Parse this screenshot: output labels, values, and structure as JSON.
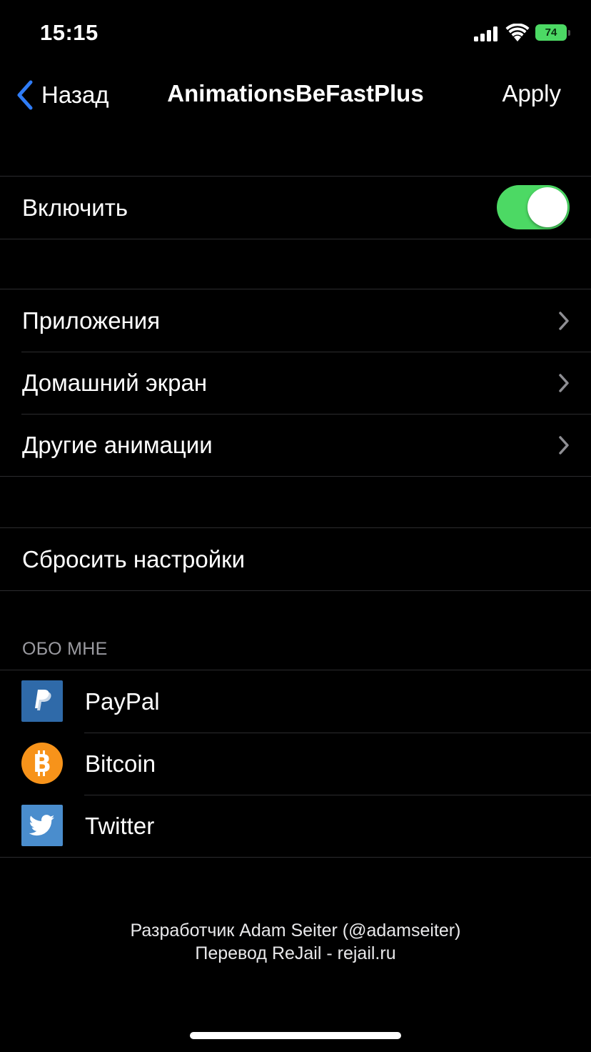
{
  "status_bar": {
    "time": "15:15",
    "battery": "74",
    "battery_color": "#4cd964"
  },
  "nav": {
    "back_label": "Назад",
    "title": "AnimationsBeFastPlus",
    "apply_label": "Apply",
    "back_icon": "chevron-left-icon"
  },
  "enable_group": {
    "label": "Включить",
    "toggle_on": true,
    "toggle_color": "#4cd964"
  },
  "menu_group": {
    "items": [
      {
        "label": "Приложения"
      },
      {
        "label": "Домашний экран"
      },
      {
        "label": "Другие анимации"
      }
    ]
  },
  "reset_group": {
    "label": "Сбросить настройки"
  },
  "about": {
    "header": "ОБО МНЕ",
    "items": [
      {
        "label": "PayPal",
        "icon": "paypal-icon"
      },
      {
        "label": "Bitcoin",
        "icon": "bitcoin-icon"
      },
      {
        "label": "Twitter",
        "icon": "twitter-icon"
      }
    ]
  },
  "footer": {
    "line1": "Разработчик Adam Seiter (@adamseiter)",
    "line2": "Перевод ReJail - rejail.ru"
  }
}
